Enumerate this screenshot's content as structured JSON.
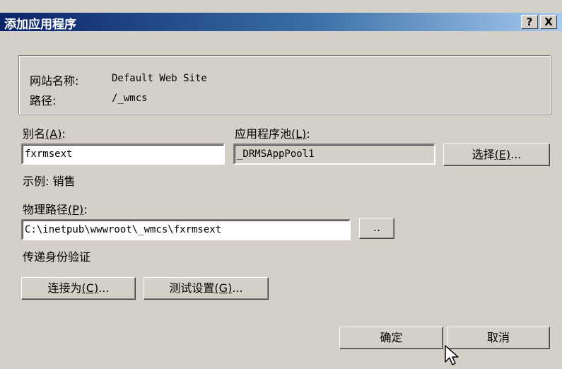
{
  "window": {
    "title": "添加应用程序",
    "help_glyph": "?",
    "close_glyph": "X"
  },
  "info": {
    "site_name_label": "网站名称:",
    "site_name_value": "Default Web Site",
    "path_label": "路径:",
    "path_value": "/_wmcs"
  },
  "alias": {
    "label": "别名",
    "mnemonic": "(A)",
    "suffix": ":",
    "value": "fxrmsext",
    "example": "示例: 销售"
  },
  "app_pool": {
    "label": "应用程序池",
    "mnemonic": "(L)",
    "suffix": ":",
    "value": "_DRMSAppPool1",
    "select_label": "选择",
    "select_mnemonic": "(E)",
    "select_suffix": "..."
  },
  "physical_path": {
    "label": "物理路径",
    "mnemonic": "(P)",
    "suffix": ":",
    "value": "C:\\inetpub\\wwwroot\\_wmcs\\fxrmsext",
    "browse_label": ".."
  },
  "auth": {
    "label": "传递身份验证",
    "connect_as_label": "连接为",
    "connect_as_mnemonic": "(C)",
    "connect_as_suffix": "...",
    "test_settings_label": "测试设置",
    "test_settings_mnemonic": "(G)",
    "test_settings_suffix": "..."
  },
  "footer": {
    "ok_label": "确定",
    "cancel_label": "取消"
  }
}
